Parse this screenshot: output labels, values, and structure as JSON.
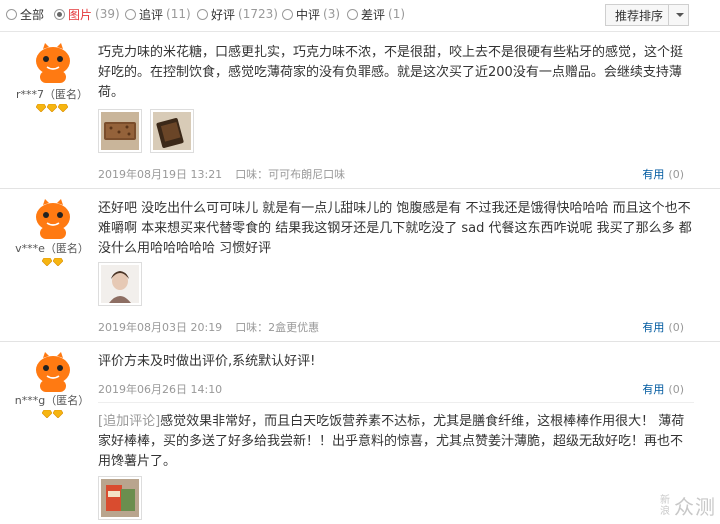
{
  "filters": [
    {
      "label": "全部",
      "count": "",
      "checked": false
    },
    {
      "label": "图片",
      "count": "(39)",
      "checked": true
    },
    {
      "label": "追评",
      "count": "(11)",
      "checked": false
    },
    {
      "label": "好评",
      "count": "(1723)",
      "checked": false
    },
    {
      "label": "中评",
      "count": "(3)",
      "checked": false
    },
    {
      "label": "差评",
      "count": "(1)",
      "checked": false
    }
  ],
  "sort": {
    "label": "推荐排序"
  },
  "reviews": [
    {
      "user": "r***7（匿名）",
      "text": "巧克力味的米花糖，口感更扎实，巧克力味不浓，不是很甜，咬上去不是很硬有些粘牙的感觉，这个挺好吃的。在控制饮食，感觉吃薄荷家的没有负罪感。就是这次买了近200没有一点赠品。会继续支持薄荷。",
      "date": "2019年08月19日 13:21",
      "spec": "口味：可可布朗尼口味",
      "useful_label": "有用",
      "useful_count": "(0)"
    },
    {
      "user": "v***e（匿名）",
      "text": "还好吧 没吃出什么可可味儿 就是有一点儿甜味儿的 饱腹感是有 不过我还是饿得快哈哈哈 而且这个也不难嚼啊 本来想买来代替零食的 结果我这钢牙还是几下就吃没了 sad 代餐这东西咋说呢 我买了那么多 都没什么用哈哈哈哈哈 习惯好评",
      "date": "2019年08月03日 20:19",
      "spec": "口味：2盒更优惠",
      "useful_label": "有用",
      "useful_count": "(0)"
    },
    {
      "user": "n***g（匿名）",
      "text": "评价方未及时做出评价,系统默认好评!",
      "date": "2019年06月26日 14:10",
      "useful_label": "有用",
      "useful_count": "(0)",
      "append_tag": "[追加评论]",
      "append_text": "感觉效果非常好，而且白天吃饭营养素不达标，尤其是膳食纤维，这根棒棒作用很大！ 薄荷家好棒棒，买的多送了好多给我尝新！！出乎意料的惊喜，尤其点赞姜汁薄脆，超级无敌好吃！再也不用馋薯片了。"
    }
  ],
  "watermark": {
    "small_top": "新",
    "small_bottom": "浪",
    "text": "众测"
  },
  "colors": {
    "accent_red": "#e4393c",
    "link_blue": "#005aa0",
    "avatar_orange": "#ff7a12",
    "medal_gold": "#f6b511"
  }
}
